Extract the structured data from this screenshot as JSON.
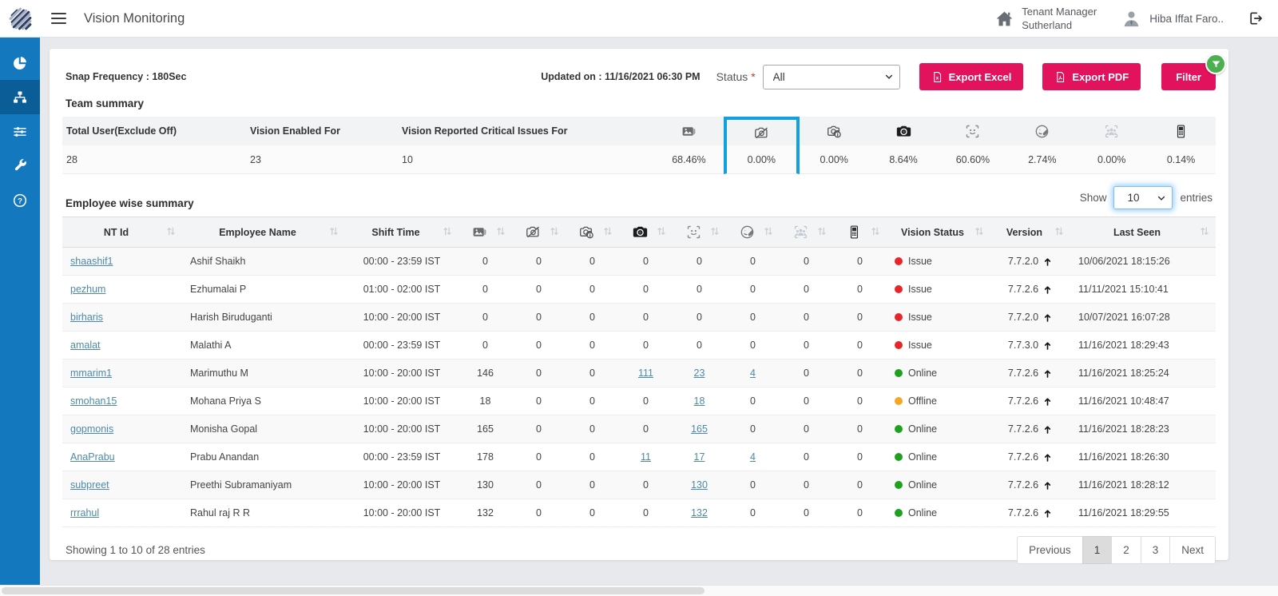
{
  "colors": {
    "accent": "#e3125c",
    "highlight_box": "#12a0e2",
    "sidebar": "#1478be",
    "sidebar_active": "#0b5d97",
    "filter_badge": "#4caf50",
    "link": "#4d8aa8"
  },
  "navbar": {
    "title": "Vision Monitoring",
    "tenant_label": "Tenant Manager",
    "tenant_name": "Sutherland",
    "user_name": "Hiba Iffat Faro.."
  },
  "toolbar": {
    "snap_frequency": "Snap Frequency : 180Sec",
    "updated_on": "Updated on : 11/16/2021 06:30 PM",
    "status_label": "Status",
    "required_mark": "*",
    "status_value": "All",
    "export_excel_label": "Export Excel",
    "export_pdf_label": "Export PDF",
    "filter_label": "Filter"
  },
  "team_summary": {
    "title": "Team summary",
    "text_columns": [
      {
        "header": "Total User(Exclude Off)",
        "value": "28"
      },
      {
        "header": "Vision Enabled For",
        "value": "23"
      },
      {
        "header": "Vision Reported Critical Issues For",
        "value": "10"
      }
    ],
    "icon_columns": [
      {
        "icon": "image-icon",
        "value": "68.46%",
        "highlighted": false
      },
      {
        "icon": "camera-off-icon",
        "value": "0.00%",
        "highlighted": true
      },
      {
        "icon": "camera-info-icon",
        "value": "0.00%",
        "highlighted": false
      },
      {
        "icon": "camera-icon",
        "value": "8.64%",
        "highlighted": false
      },
      {
        "icon": "face-scan-icon",
        "value": "60.60%",
        "highlighted": false
      },
      {
        "icon": "face-covered-icon",
        "value": "2.74%",
        "highlighted": false
      },
      {
        "icon": "multiple-people-icon",
        "value": "0.00%",
        "highlighted": false
      },
      {
        "icon": "mobile-icon",
        "value": "0.14%",
        "highlighted": false
      }
    ]
  },
  "employee_summary": {
    "title": "Employee wise summary",
    "show_label": "Show",
    "entries_label": "entries",
    "page_size": "10",
    "status_colors": {
      "Issue": "#e8262a",
      "Online": "#1fa11f",
      "Offline": "#f5a623"
    },
    "columns": [
      {
        "type": "text",
        "label": "NT Id"
      },
      {
        "type": "text",
        "label": "Employee Name"
      },
      {
        "type": "text",
        "label": "Shift Time"
      },
      {
        "type": "icon",
        "icon": "image-icon"
      },
      {
        "type": "icon",
        "icon": "camera-off-icon"
      },
      {
        "type": "icon",
        "icon": "camera-info-icon"
      },
      {
        "type": "icon",
        "icon": "camera-icon"
      },
      {
        "type": "icon",
        "icon": "face-scan-icon"
      },
      {
        "type": "icon",
        "icon": "face-covered-icon"
      },
      {
        "type": "icon",
        "icon": "multiple-people-icon"
      },
      {
        "type": "icon",
        "icon": "mobile-icon"
      },
      {
        "type": "text",
        "label": "Vision Status"
      },
      {
        "type": "text",
        "label": "Version"
      },
      {
        "type": "text",
        "label": "Last Seen"
      }
    ],
    "rows": [
      {
        "nt_id": "shaashif1",
        "name": "Ashif Shaikh",
        "shift": "00:00 - 23:59 IST",
        "counts": [
          "0",
          "0",
          "0",
          "0",
          "0",
          "0",
          "0",
          "0"
        ],
        "link_cols": [],
        "status": "Issue",
        "version": "7.7.2.0",
        "last_seen": "10/06/2021 18:15:26"
      },
      {
        "nt_id": "pezhum",
        "name": "Ezhumalai P",
        "shift": "01:00 - 02:00 IST",
        "counts": [
          "0",
          "0",
          "0",
          "0",
          "0",
          "0",
          "0",
          "0"
        ],
        "link_cols": [],
        "status": "Issue",
        "version": "7.7.2.6",
        "last_seen": "11/11/2021 15:10:41"
      },
      {
        "nt_id": "birharis",
        "name": "Harish Biruduganti",
        "shift": "10:00 - 20:00 IST",
        "counts": [
          "0",
          "0",
          "0",
          "0",
          "0",
          "0",
          "0",
          "0"
        ],
        "link_cols": [],
        "status": "Issue",
        "version": "7.7.2.0",
        "last_seen": "10/07/2021 16:07:28"
      },
      {
        "nt_id": "amalat",
        "name": "Malathi A",
        "shift": "00:00 - 23:59 IST",
        "counts": [
          "0",
          "0",
          "0",
          "0",
          "0",
          "0",
          "0",
          "0"
        ],
        "link_cols": [],
        "status": "Issue",
        "version": "7.7.3.0",
        "last_seen": "11/16/2021 18:29:43"
      },
      {
        "nt_id": "mmarim1",
        "name": "Marimuthu M",
        "shift": "10:00 - 20:00 IST",
        "counts": [
          "146",
          "0",
          "0",
          "111",
          "23",
          "4",
          "0",
          "0"
        ],
        "link_cols": [
          3,
          4,
          5
        ],
        "status": "Online",
        "version": "7.7.2.6",
        "last_seen": "11/16/2021 18:25:24"
      },
      {
        "nt_id": "smohan15",
        "name": "Mohana Priya S",
        "shift": "10:00 - 20:00 IST",
        "counts": [
          "18",
          "0",
          "0",
          "0",
          "18",
          "0",
          "0",
          "0"
        ],
        "link_cols": [
          4
        ],
        "status": "Offline",
        "version": "7.7.2.6",
        "last_seen": "11/16/2021 10:48:47"
      },
      {
        "nt_id": "gopmonis",
        "name": "Monisha Gopal",
        "shift": "10:00 - 20:00 IST",
        "counts": [
          "165",
          "0",
          "0",
          "0",
          "165",
          "0",
          "0",
          "0"
        ],
        "link_cols": [
          4
        ],
        "status": "Online",
        "version": "7.7.2.6",
        "last_seen": "11/16/2021 18:28:23"
      },
      {
        "nt_id": "AnaPrabu",
        "name": "Prabu Anandan",
        "shift": "00:00 - 23:59 IST",
        "counts": [
          "178",
          "0",
          "0",
          "11",
          "17",
          "4",
          "0",
          "0"
        ],
        "link_cols": [
          3,
          4,
          5
        ],
        "status": "Online",
        "version": "7.7.2.6",
        "last_seen": "11/16/2021 18:26:30"
      },
      {
        "nt_id": "subpreet",
        "name": "Preethi Subramaniyam",
        "shift": "10:00 - 20:00 IST",
        "counts": [
          "130",
          "0",
          "0",
          "0",
          "130",
          "0",
          "0",
          "0"
        ],
        "link_cols": [
          4
        ],
        "status": "Online",
        "version": "7.7.2.6",
        "last_seen": "11/16/2021 18:28:12"
      },
      {
        "nt_id": "rrrahul",
        "name": "Rahul raj R R",
        "shift": "10:00 - 20:00 IST",
        "counts": [
          "132",
          "0",
          "0",
          "0",
          "132",
          "0",
          "0",
          "0"
        ],
        "link_cols": [
          4
        ],
        "status": "Online",
        "version": "7.7.2.6",
        "last_seen": "11/16/2021 18:29:55"
      }
    ]
  },
  "footer": {
    "showing_text": "Showing 1 to 10 of 28 entries",
    "pages": [
      "Previous",
      "1",
      "2",
      "3",
      "Next"
    ],
    "active_page": "1"
  },
  "sidebar": {
    "items": [
      {
        "icon": "pie-chart-icon",
        "active": false
      },
      {
        "icon": "sitemap-icon",
        "active": true
      },
      {
        "icon": "sliders-icon",
        "active": false
      },
      {
        "icon": "wrench-icon",
        "active": false
      },
      {
        "icon": "help-icon",
        "active": false
      }
    ]
  }
}
